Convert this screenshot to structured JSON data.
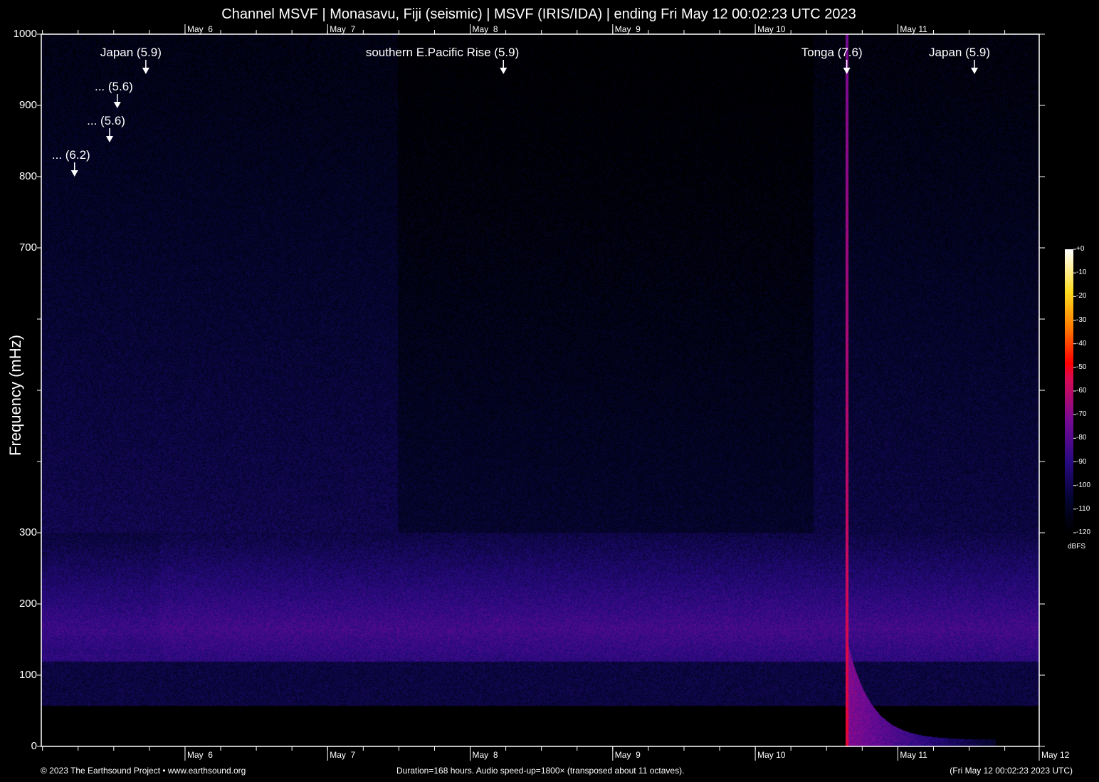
{
  "chart_data": {
    "type": "heatmap",
    "title": "Channel MSVF | Monasavu, Fiji (seismic) | MSVF (IRIS/IDA) | ending Fri May 12 00:02:23 UTC 2023",
    "ylabel": "Frequency (mHz)",
    "ylim": [
      0,
      1000
    ],
    "y_ticks": [
      0,
      100,
      200,
      300,
      400,
      500,
      600,
      700,
      800,
      900,
      1000
    ],
    "y_tick_labels": [
      "0",
      "100",
      "200",
      "300",
      "",
      "",
      "",
      "700",
      "800",
      "900",
      "1000"
    ],
    "duration_hours": 168,
    "x_day_labels": [
      {
        "label": "May  6",
        "hour": 24.2
      },
      {
        "label": "May  7",
        "hour": 48.2
      },
      {
        "label": "May  8",
        "hour": 72.2
      },
      {
        "label": "May  9",
        "hour": 96.2
      },
      {
        "label": "May 10",
        "hour": 120.2
      },
      {
        "label": "May 11",
        "hour": 144.2
      },
      {
        "label": "May 12",
        "hour": 168
      }
    ],
    "events": [
      {
        "label": "... (6.2)",
        "hour": 5.6,
        "freq": 800
      },
      {
        "label": "... (5.6)",
        "hour": 11.5,
        "freq": 848
      },
      {
        "label": "... (5.6)",
        "hour": 12.8,
        "freq": 896
      },
      {
        "label": "Japan (5.9)",
        "hour": 17.6,
        "freq": 944
      },
      {
        "label": "southern E.Pacific Rise (5.9)",
        "hour": 77.8,
        "freq": 944
      },
      {
        "label": "Tonga (7.6)",
        "hour": 135.6,
        "freq": 944
      },
      {
        "label": "Japan (5.9)",
        "hour": 157.1,
        "freq": 944
      }
    ],
    "colorbar": {
      "label": "dBFS",
      "ticks": [
        "+0",
        "-10",
        "-20",
        "-30",
        "-40",
        "-50",
        "-60",
        "-70",
        "-80",
        "-90",
        "-100",
        "-110",
        "-120"
      ],
      "range": [
        -120,
        0
      ]
    }
  },
  "footer": {
    "left": "© 2023 The Earthsound Project • www.earthsound.org",
    "center": "Duration=168 hours. Audio speed-up=1800× (transposed about 11 octaves).",
    "right": "(Fri May 12 00:02:23 2023 UTC)"
  }
}
